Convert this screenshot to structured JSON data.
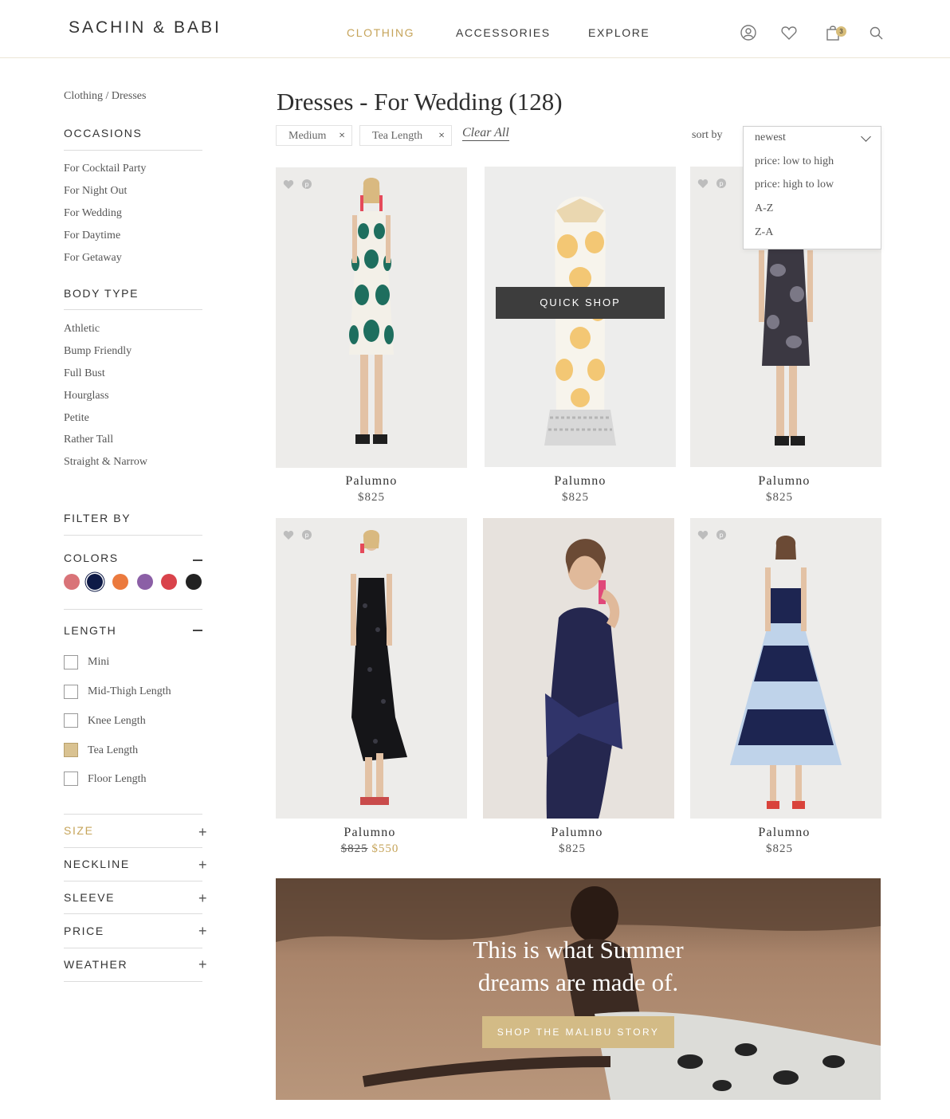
{
  "header": {
    "logo": "SACHIN & BABI",
    "nav": [
      "CLOTHING",
      "ACCESSORIES",
      "EXPLORE"
    ],
    "cart_count": "3"
  },
  "sidebar": {
    "breadcrumb": "Clothing / Dresses",
    "occasions_title": "OCCASIONS",
    "occasions": [
      "For Cocktail Party",
      "For Night Out",
      "For Wedding",
      "For Daytime",
      "For Getaway"
    ],
    "bodytype_title": "BODY TYPE",
    "bodytypes": [
      "Athletic",
      "Bump Friendly",
      "Full Bust",
      "Hourglass",
      "Petite",
      "Rather Tall",
      "Straight & Narrow"
    ],
    "filter_title": "FILTER BY",
    "colors_title": "COLORS",
    "colors": [
      "#d97378",
      "#0e1a47",
      "#eb7a3e",
      "#8b5fa6",
      "#d9434b",
      "#222222"
    ],
    "length_title": "LENGTH",
    "lengths": [
      {
        "label": "Mini",
        "checked": false
      },
      {
        "label": "Mid-Thigh Length",
        "checked": false
      },
      {
        "label": "Knee Length",
        "checked": false
      },
      {
        "label": "Tea Length",
        "checked": true
      },
      {
        "label": "Floor Length",
        "checked": false
      }
    ],
    "filters": [
      "SIZE",
      "NECKLINE",
      "SLEEVE",
      "PRICE",
      "WEATHER"
    ]
  },
  "main": {
    "title": "Dresses - For Wedding (128)",
    "chips": [
      "Medium",
      "Tea Length"
    ],
    "chip_close": "×",
    "clear_all": "Clear All",
    "sort_label": "sort by",
    "sort_options": [
      "newest",
      "price: low to high",
      "price: high to low",
      "A-Z",
      "Z-A"
    ],
    "quick_shop": "QUICK SHOP",
    "products": [
      {
        "name": "Palumno",
        "price": "$825",
        "sale": ""
      },
      {
        "name": "Palumno",
        "price": "$825",
        "sale": ""
      },
      {
        "name": "Palumno",
        "price": "$825",
        "sale": ""
      },
      {
        "name": "Palumno",
        "price": "$825",
        "sale": "$550"
      },
      {
        "name": "Palumno",
        "price": "$825",
        "sale": ""
      },
      {
        "name": "Palumno",
        "price": "$825",
        "sale": ""
      }
    ]
  },
  "banner": {
    "line1": "This is what Summer",
    "line2": "dreams are made of.",
    "button": "SHOP THE MALIBU STORY"
  }
}
